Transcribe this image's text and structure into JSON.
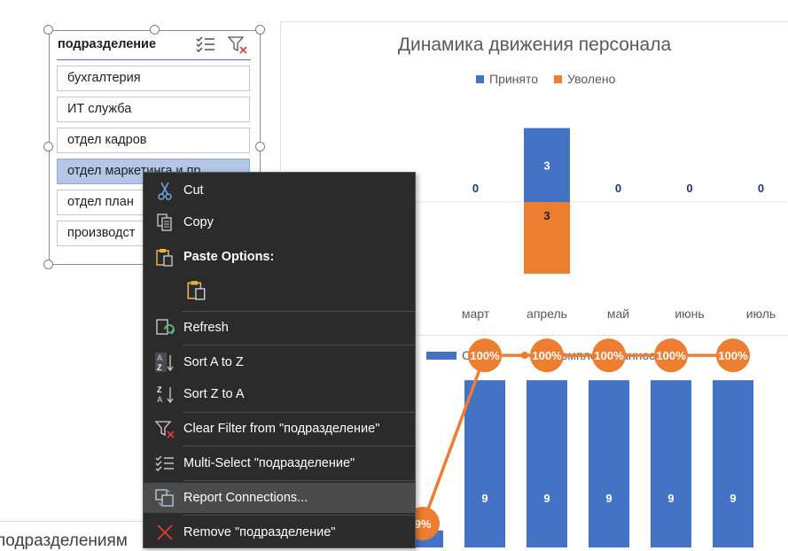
{
  "slicer": {
    "title": "подразделение",
    "items": [
      {
        "label": "бухгалтерия",
        "selected": false
      },
      {
        "label": "ИТ служба",
        "selected": false
      },
      {
        "label": "отдел кадров",
        "selected": false
      },
      {
        "label": "отдел маркетинга и пр",
        "selected": true
      },
      {
        "label": "отдел план",
        "selected": false
      },
      {
        "label": "производст",
        "selected": false
      }
    ],
    "icons": [
      "multi-select-icon",
      "clear-filter-icon"
    ]
  },
  "background_text": "подразделениям",
  "chart_data": [
    {
      "type": "bar",
      "title": "Динамика движения персонала",
      "categories": [
        "ль",
        "март",
        "апрель",
        "май",
        "июнь",
        "июль"
      ],
      "series": [
        {
          "name": "Принято",
          "color": "#4472c4",
          "values": [
            null,
            0,
            3,
            0,
            0,
            0
          ]
        },
        {
          "name": "Уволено",
          "color": "#ed7d31",
          "values": [
            null,
            null,
            3,
            null,
            null,
            null
          ]
        }
      ],
      "data_labels": [
        "0",
        "3",
        "3",
        "0",
        "0",
        "0"
      ],
      "legend": "top",
      "grid": false
    },
    {
      "type": "bar",
      "title": "",
      "categories": [
        "",
        "",
        "",
        "",
        "",
        ""
      ],
      "series": [
        {
          "name": "ССЧ",
          "type": "bar",
          "color": "#4472c4",
          "values": [
            1,
            9,
            9,
            9,
            9,
            9
          ]
        },
        {
          "name": "Укомплектованность",
          "type": "line",
          "color": "#ed7d31",
          "values": [
            9,
            100,
            100,
            100,
            100,
            100
          ]
        }
      ],
      "data_labels": [
        "9",
        "9",
        "9",
        "9",
        "9",
        "9%",
        "100%",
        "100%",
        "100%",
        "100%",
        "100%"
      ],
      "legend": "top",
      "grid": false
    }
  ],
  "context_menu": {
    "items": [
      {
        "name": "cut",
        "label": "Cut",
        "icon": "scissors-icon"
      },
      {
        "name": "copy",
        "label": "Copy",
        "icon": "copy-icon"
      },
      {
        "name": "paste-options",
        "label": "Paste Options:",
        "icon": "paste-icon"
      },
      {
        "name": "refresh",
        "label": "Refresh",
        "icon": "refresh-icon"
      },
      {
        "name": "sort-a-z",
        "label": "Sort A to Z",
        "icon": "sort-ascending-icon"
      },
      {
        "name": "sort-z-a",
        "label": "Sort Z to A",
        "icon": "sort-descending-icon"
      },
      {
        "name": "clear-filter",
        "label": "Clear Filter from \"подразделение\"",
        "icon": "clear-filter-icon"
      },
      {
        "name": "multi-select",
        "label": "Multi-Select \"подразделение\"",
        "icon": "multi-select-icon"
      },
      {
        "name": "report-connections",
        "label": "Report Connections...",
        "icon": "report-connections-icon",
        "highlighted": true
      },
      {
        "name": "remove",
        "label": "Remove \"подразделение\"",
        "icon": "remove-icon"
      }
    ]
  }
}
